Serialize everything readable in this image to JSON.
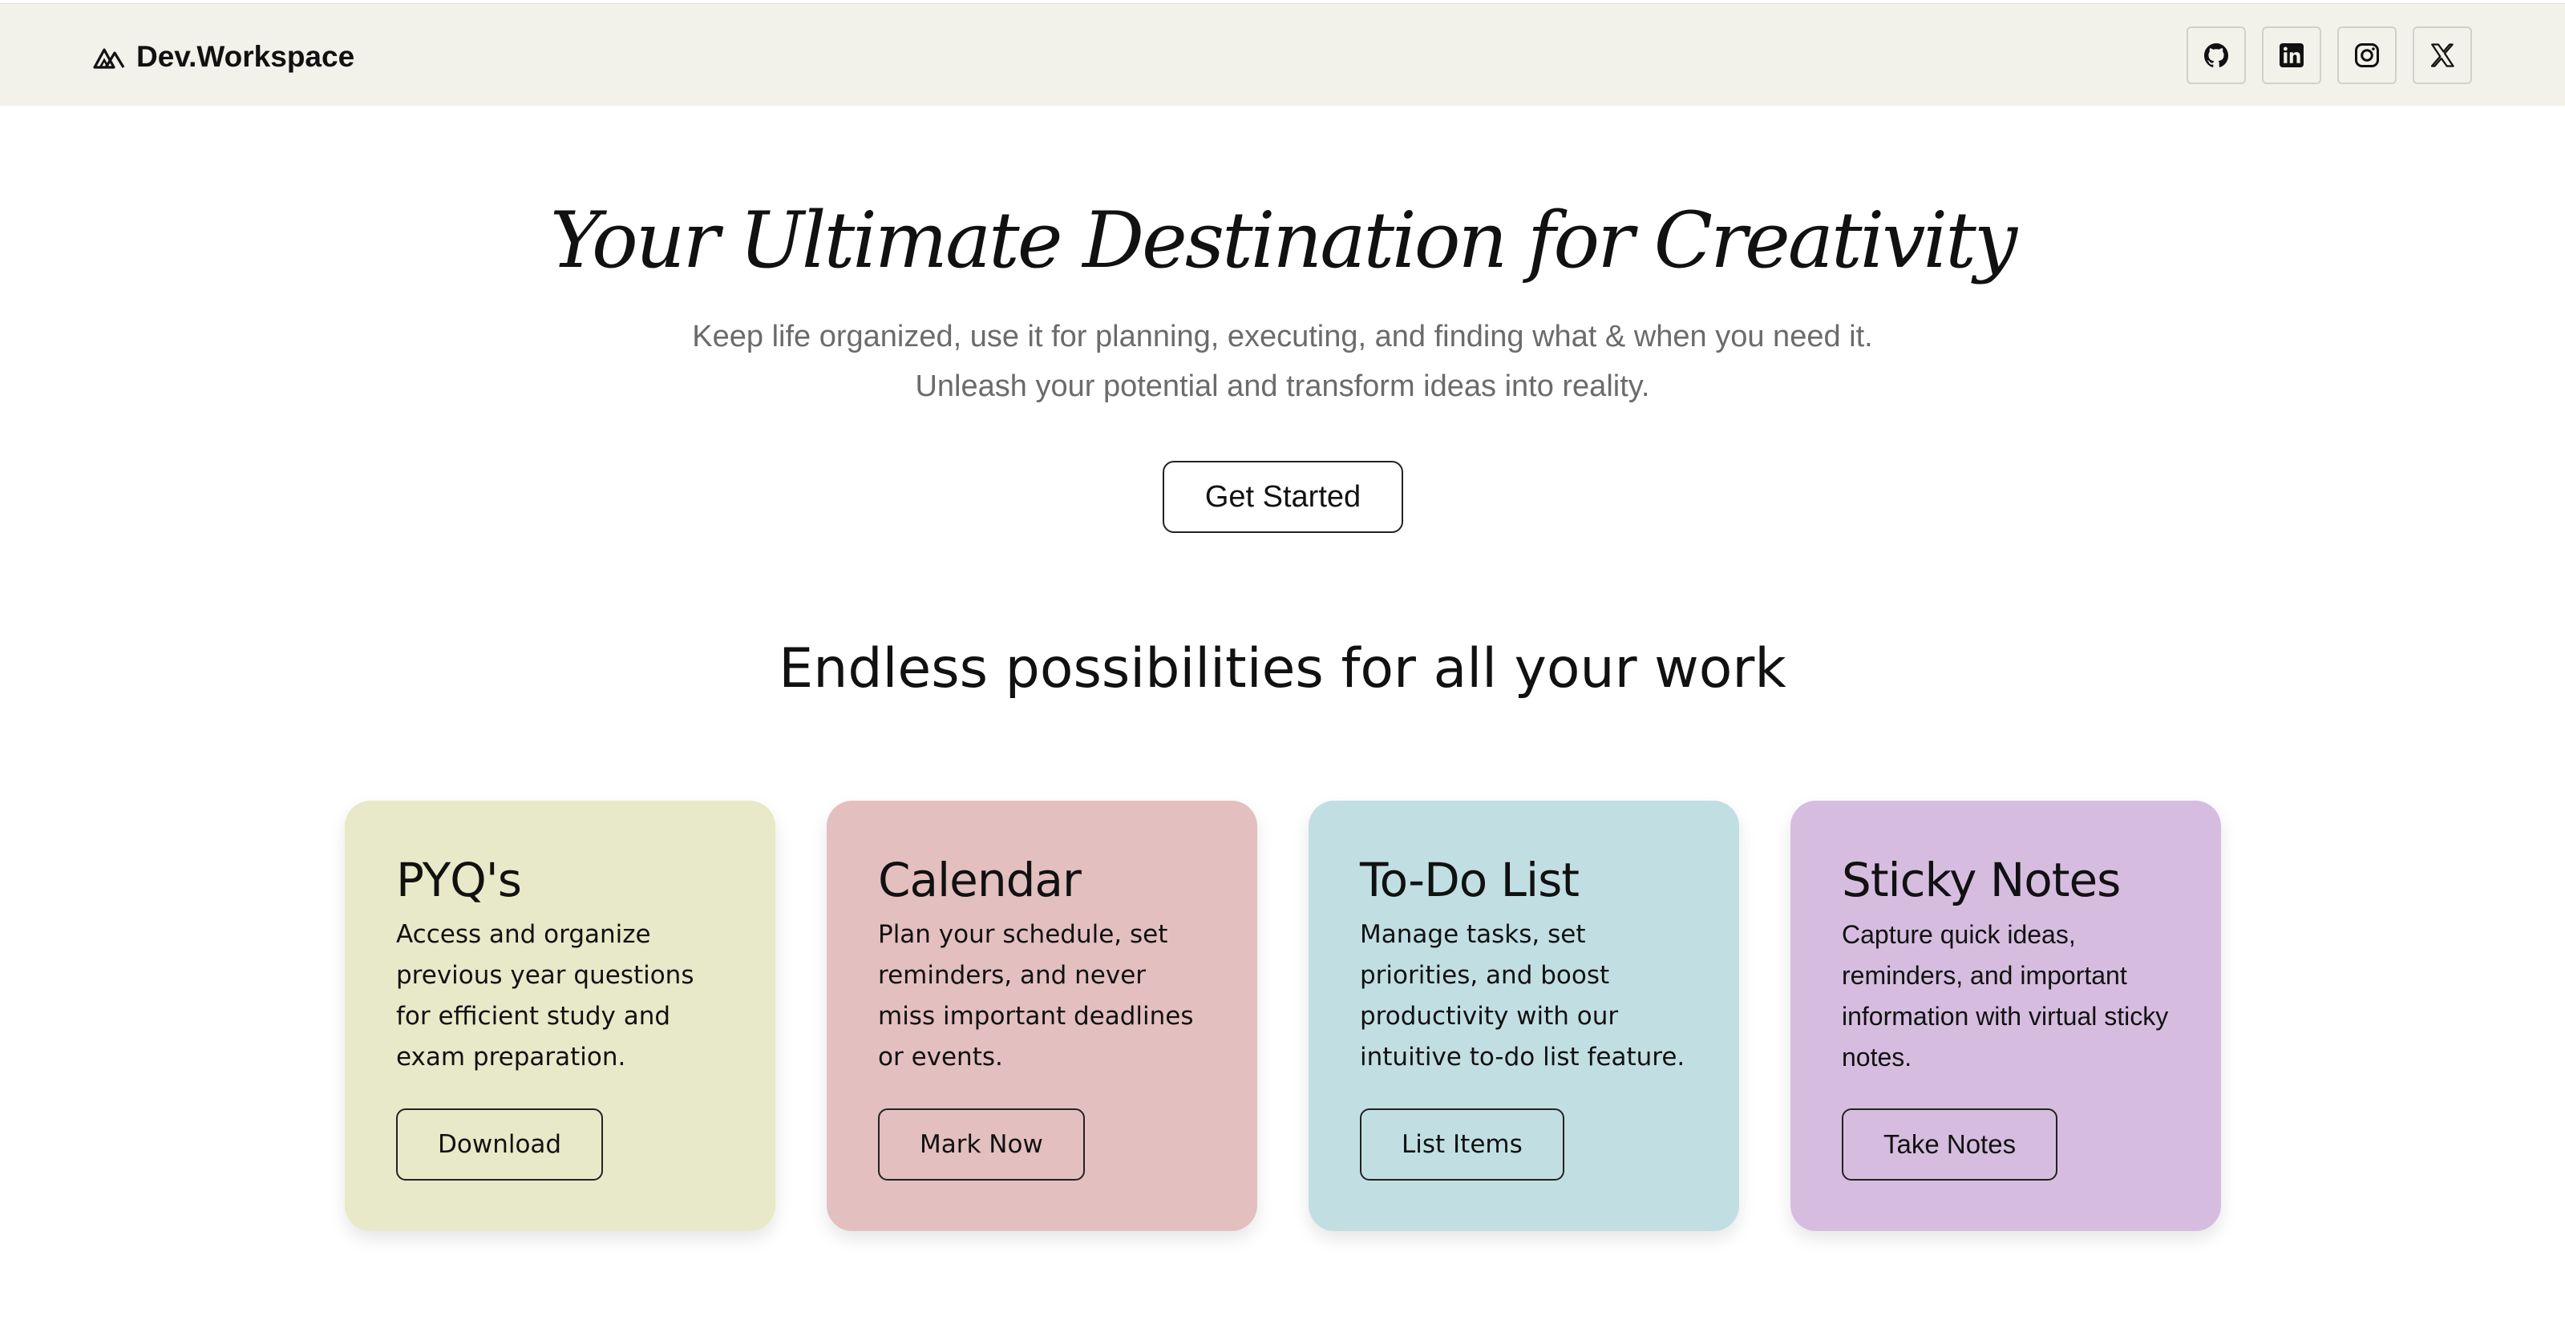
{
  "nav": {
    "brand": "Dev.Workspace",
    "logo_icon": "mountain-logo-icon",
    "socials": [
      {
        "icon": "github-icon"
      },
      {
        "icon": "linkedin-icon"
      },
      {
        "icon": "instagram-icon"
      },
      {
        "icon": "x-twitter-icon"
      }
    ]
  },
  "hero": {
    "title": "Your Ultimate Destination for Creativity",
    "subtitle_line1": "Keep life organized, use it for planning, executing, and finding what & when you need it.",
    "subtitle_line2": "Unleash your potential and transform ideas into reality.",
    "cta_label": "Get Started"
  },
  "features": {
    "heading": "Endless possibilities for all your work",
    "cards": [
      {
        "title": "PYQ's",
        "description": "Access and organize previous year questions for efficient study and exam preparation.",
        "button": "Download",
        "color": "#e8e9c8"
      },
      {
        "title": "Calendar",
        "description": "Plan your schedule, set reminders, and never miss important deadlines or events.",
        "button": "Mark Now",
        "color": "#e4bfc0"
      },
      {
        "title": "To-Do List",
        "description": "Manage tasks, set priorities, and boost productivity with our intuitive to-do list feature.",
        "button": "List Items",
        "color": "#c1dfe3"
      },
      {
        "title": "Sticky Notes",
        "description": "Capture quick ideas, reminders, and important information with virtual sticky notes.",
        "button": "Take Notes",
        "color": "#d6bde0"
      }
    ]
  },
  "colors": {
    "nav_bg": "#f2f1ea",
    "text": "#111111",
    "muted": "#6b6b6b"
  }
}
